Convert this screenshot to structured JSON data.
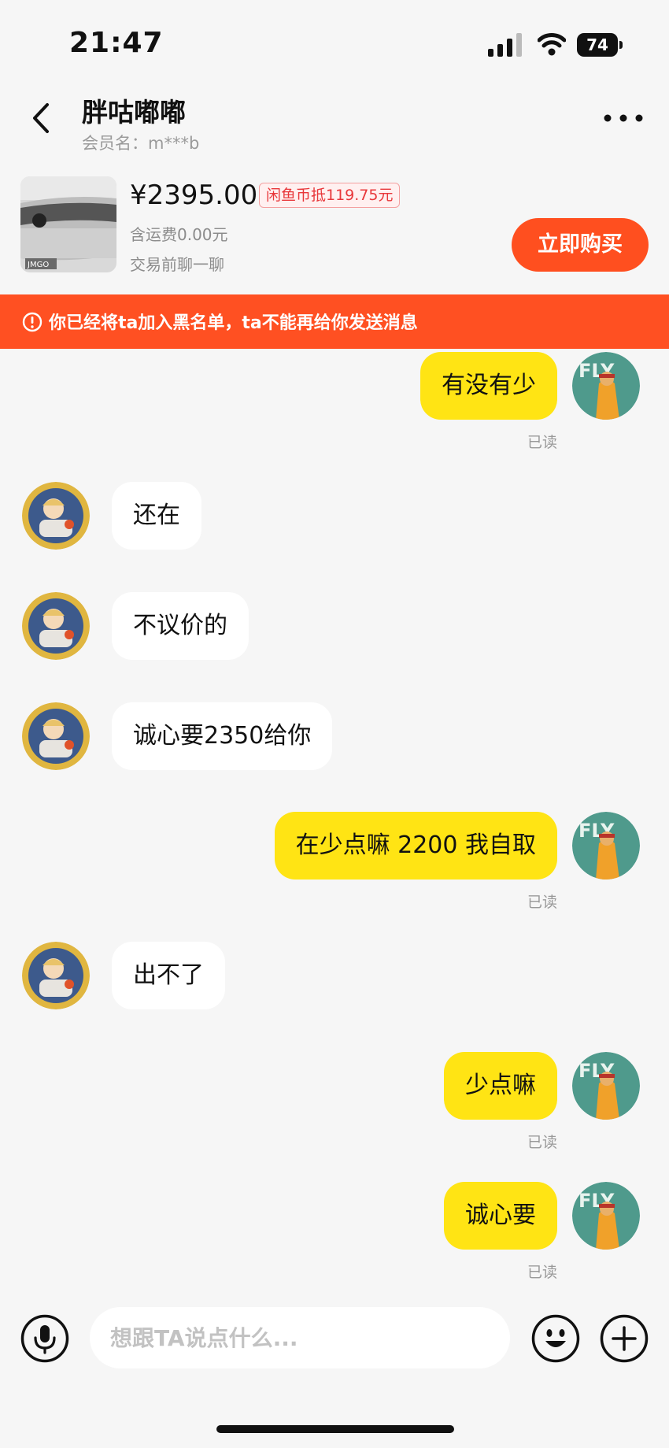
{
  "status_bar": {
    "time": "21:47",
    "battery": "74"
  },
  "header": {
    "title": "胖咕嘟嘟",
    "subtitle": "会员名：m***b"
  },
  "product": {
    "price": "¥2395.00",
    "coin_discount": "闲鱼币抵119.75元",
    "shipping": "含运费0.00元",
    "chat_hint": "交易前聊一聊",
    "buy_label": "立即购买",
    "thumb_brand": "JMGO"
  },
  "banner": {
    "text": "你已经将ta加入黑名单，ta不能再给你发送消息"
  },
  "messages": [
    {
      "from": "me",
      "text": "有没有少",
      "read": "已读"
    },
    {
      "from": "them",
      "text": "还在"
    },
    {
      "from": "them",
      "text": "不议价的"
    },
    {
      "from": "them",
      "text": "诚心要2350给你"
    },
    {
      "from": "me",
      "text": "在少点嘛 2200 我自取",
      "read": "已读"
    },
    {
      "from": "them",
      "text": "出不了"
    },
    {
      "from": "me",
      "text": "少点嘛",
      "read": "已读"
    },
    {
      "from": "me",
      "text": "诚心要",
      "read": "已读"
    }
  ],
  "input": {
    "placeholder": "想跟TA说点什么..."
  },
  "icons": {
    "back": "chevron-left-icon",
    "more": "more-dots-icon",
    "warning": "exclamation-circle-icon",
    "mic": "microphone-icon",
    "emoji": "smiley-icon",
    "plus": "plus-circle-icon"
  },
  "colors": {
    "accent": "#ff4f1f",
    "my_bubble": "#ffe414",
    "their_bubble": "#ffffff",
    "background": "#f6f6f6"
  }
}
